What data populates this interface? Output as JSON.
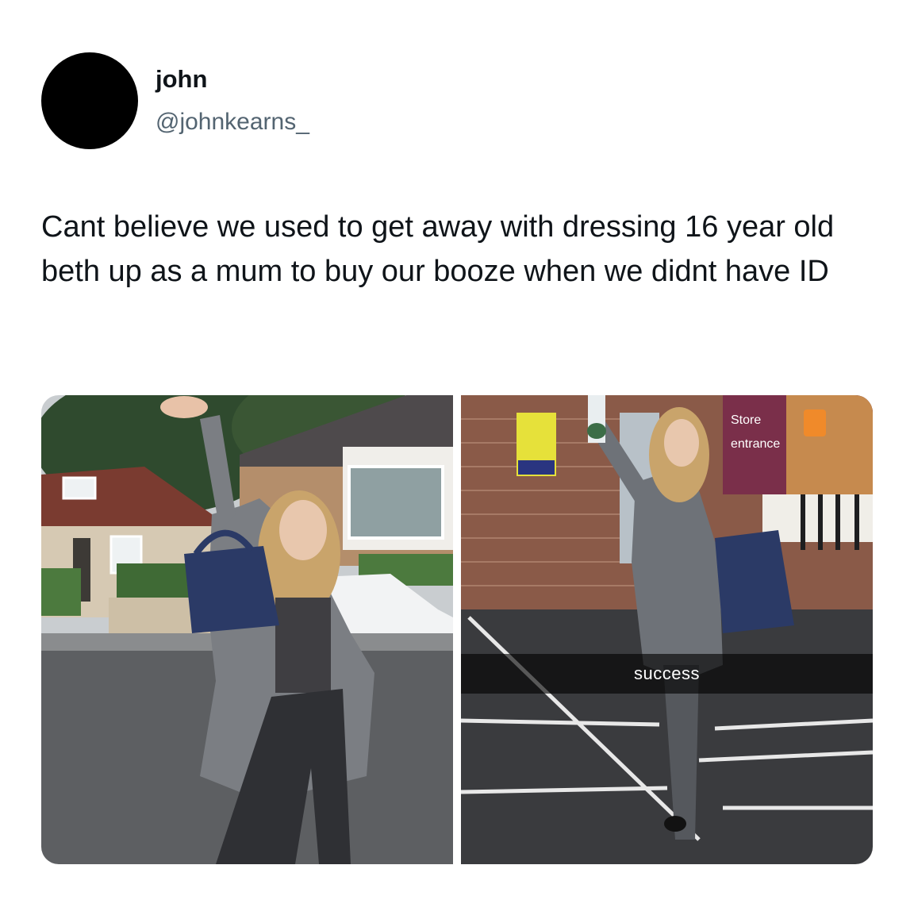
{
  "tweet": {
    "author": {
      "display_name": "john",
      "handle": "@johnkearns_"
    },
    "text": "Cant believe we used to get away with dressing 16 year old beth up as a mum to buy our booze when we didnt have ID",
    "media": [
      {
        "alt_subject": "woman-posing-on-residential-street"
      },
      {
        "alt_subject": "woman-walking-in-store-car-park",
        "caption": "success",
        "sign_line1": "Store",
        "sign_line2": "entrance"
      }
    ]
  },
  "colors": {
    "text_primary": "#0f1419",
    "text_secondary": "#536471",
    "background": "#ffffff"
  }
}
